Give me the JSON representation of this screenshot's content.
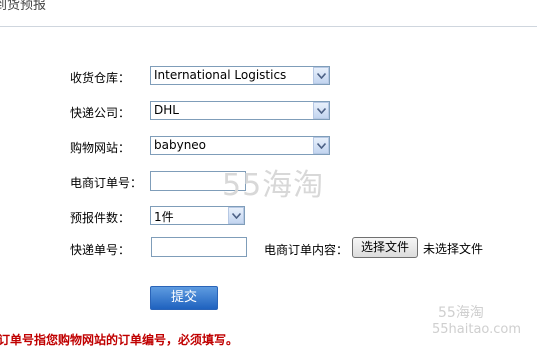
{
  "header": {
    "title": "到货预报"
  },
  "form": {
    "warehouse": {
      "label": "收货仓库：",
      "value": "International Logistics"
    },
    "courier": {
      "label": "快递公司：",
      "value": "DHL"
    },
    "site": {
      "label": "购物网站：",
      "value": "babyneo"
    },
    "order_no": {
      "label": "电商订单号：",
      "value": ""
    },
    "pieces": {
      "label": "预报件数：",
      "value": "1件"
    },
    "tracking_no": {
      "label": "快递单号：",
      "value": ""
    },
    "order_content": {
      "label": "电商订单内容：",
      "button": "选择文件",
      "status": "未选择文件"
    },
    "submit": "提交"
  },
  "note": "订单号指您购物网站的订单编号，必须填写。",
  "watermarks": {
    "center": "55海淘",
    "bottom_cn": "55海淘",
    "bottom_url": "55haitao.com"
  },
  "colors": {
    "note": "#c00000",
    "submit_bg": "#2c6fc9",
    "watermark": "#d3d3d3"
  }
}
